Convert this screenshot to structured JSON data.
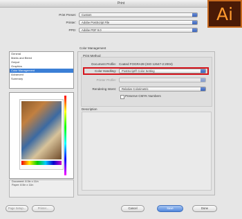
{
  "window": {
    "title": "Print"
  },
  "brand": {
    "logo_text": "Ai",
    "logo_color": "#ff9a2e"
  },
  "top_fields": [
    {
      "label": "Print Preset:",
      "value": "Custom"
    },
    {
      "label": "Printer:",
      "value": "Adobe PostScript File"
    },
    {
      "label": "PPD:",
      "value": "Adobe PDF 9.0"
    }
  ],
  "sidebar": {
    "items": [
      "General",
      "Marks and Bleed",
      "Output",
      "Graphics",
      "Color Management",
      "Advanced",
      "Summary"
    ],
    "selected_index": 4
  },
  "color_management": {
    "section_title": "Color Management",
    "group_title": "Print Method",
    "document_profile_label": "Document Profile:",
    "document_profile_value": "Coated FOGRA39 (ISO 12647-2:2004)",
    "color_handling_label": "Color Handling:",
    "color_handling_value": "PostScript® Color Setting",
    "printer_profile_label": "Printer Profile:",
    "printer_profile_value": "",
    "rendering_intent_label": "Rendering Intent:",
    "rendering_intent_value": "Relative Colorimetric",
    "preserve_label": "Preserve CMYK Numbers",
    "highlight_color": "#d6141c"
  },
  "description": {
    "title": "Description"
  },
  "preview_info": {
    "line1": "Document: 8.5in x 11in",
    "line2": "Paper: 8.5in x 11in"
  },
  "buttons": {
    "page_setup": "Page Setup...",
    "printer": "Printer...",
    "cancel": "Cancel",
    "save": "Save",
    "done": "Done"
  }
}
